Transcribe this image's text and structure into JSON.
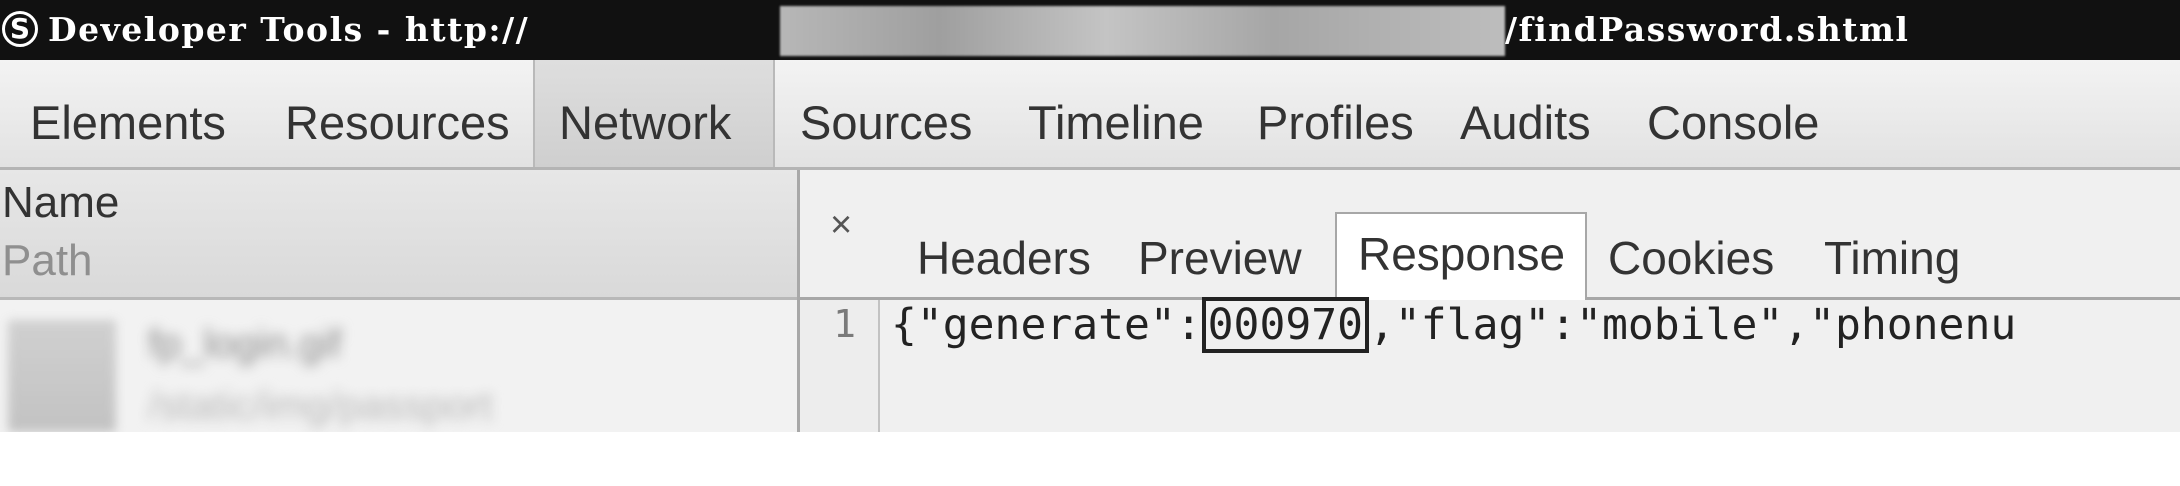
{
  "window": {
    "title_left": "Developer Tools - http://",
    "title_right": "/findPassword.shtml",
    "app_icon_glyph": "S",
    "redacted_url": true
  },
  "main_tabs": [
    {
      "label": "Elements",
      "active": false
    },
    {
      "label": "Resources",
      "active": false
    },
    {
      "label": "Network",
      "active": true
    },
    {
      "label": "Sources",
      "active": false
    },
    {
      "label": "Timeline",
      "active": false
    },
    {
      "label": "Profiles",
      "active": false
    },
    {
      "label": "Audits",
      "active": false
    },
    {
      "label": "Console",
      "active": false
    }
  ],
  "left_panel": {
    "column_name": "Name",
    "column_path": "Path",
    "request_row": {
      "name": "fp_login.gif",
      "path": "/static/img/passport"
    }
  },
  "detail_panel": {
    "close_icon": "×",
    "tabs": [
      {
        "label": "Headers",
        "active": false
      },
      {
        "label": "Preview",
        "active": false
      },
      {
        "label": "Response",
        "active": true
      },
      {
        "label": "Cookies",
        "active": false
      },
      {
        "label": "Timing",
        "active": false
      }
    ],
    "response": {
      "line_number": "1",
      "prefix": "{\"generate\":",
      "highlighted_value": "000970",
      "suffix": ",\"flag\":\"mobile\",\"phonenu"
    }
  },
  "colors": {
    "titlebar_bg": "#111111",
    "active_tab_bg": "#d6d6d6",
    "panel_bg": "#f0f0f0"
  }
}
